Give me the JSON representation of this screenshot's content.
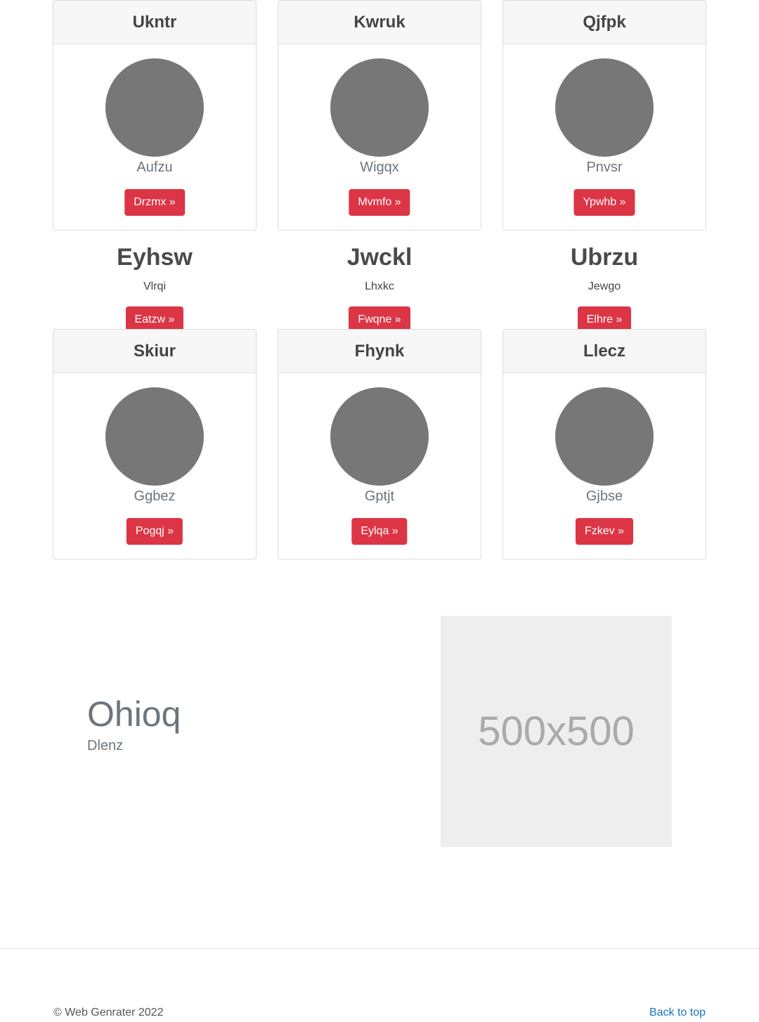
{
  "profile_cards_top": [
    {
      "title": "Ukntr",
      "subtitle": "Aufzu",
      "button": "Drzmx »"
    },
    {
      "title": "Kwruk",
      "subtitle": "Wigqx",
      "button": "Mvmfo »"
    },
    {
      "title": "Qjfpk",
      "subtitle": "Pnvsr",
      "button": "Ypwhb »"
    }
  ],
  "features": [
    {
      "title": "Eyhsw",
      "subtitle": "Vlrqi",
      "button": "Eatzw »"
    },
    {
      "title": "Jwckl",
      "subtitle": "Lhxkc",
      "button": "Fwqne »"
    },
    {
      "title": "Ubrzu",
      "subtitle": "Jewgo",
      "button": "Elhre »"
    }
  ],
  "profile_cards_bottom": [
    {
      "title": "Skiur",
      "subtitle": "Ggbez",
      "button": "Pogqj »"
    },
    {
      "title": "Fhynk",
      "subtitle": "Gptjt",
      "button": "Eylqa »"
    },
    {
      "title": "Llecz",
      "subtitle": "Gjbse",
      "button": "Fzkev »"
    }
  ],
  "hero": {
    "title": "Ohioq",
    "subtitle": "Dlenz",
    "placeholder_text": "500x500"
  },
  "footer": {
    "copyright": "© Web Genrater 2022",
    "back_to_top": "Back to top"
  },
  "colors": {
    "button": "#dc3545",
    "avatar": "#777777",
    "link": "#1a73c8"
  }
}
